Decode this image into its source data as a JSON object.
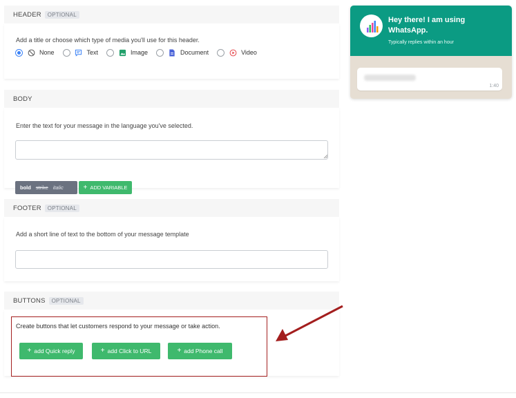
{
  "header": {
    "title": "HEADER",
    "badge": "OPTIONAL",
    "hint": "Add a title or choose which type of media you'll use for this header.",
    "options": [
      {
        "label": "None",
        "icon": "no-entry-icon",
        "selected": true
      },
      {
        "label": "Text",
        "icon": "chat-text-icon",
        "selected": false
      },
      {
        "label": "Image",
        "icon": "image-icon",
        "selected": false
      },
      {
        "label": "Document",
        "icon": "document-icon",
        "selected": false
      },
      {
        "label": "Video",
        "icon": "play-circle-icon",
        "selected": false
      }
    ]
  },
  "body_section": {
    "title": "BODY",
    "hint": "Enter the text for your message in the language you've selected.",
    "text_value": "",
    "format": {
      "bold": "bold",
      "strike": "strike",
      "italic": "italic"
    },
    "add_variable": "ADD VARIABLE"
  },
  "footer": {
    "title": "FOOTER",
    "badge": "OPTIONAL",
    "hint": "Add a short line of text to the bottom of your message template",
    "input_value": ""
  },
  "buttons": {
    "title": "BUTTONS",
    "badge": "OPTIONAL",
    "hint": "Create buttons that let customers respond to your message or take action.",
    "items": [
      "add Quick reply",
      "add Click to URL",
      "add Phone call"
    ]
  },
  "preview": {
    "title": "Hey there! I am using WhatsApp.",
    "subtitle": "Typically replies within an hour",
    "time": "1:40"
  },
  "colors": {
    "accent_green": "#3fb96d",
    "whatsapp_teal": "#0b9b83",
    "callout_red": "#a31e1e",
    "radio_blue": "#3b82f6"
  }
}
